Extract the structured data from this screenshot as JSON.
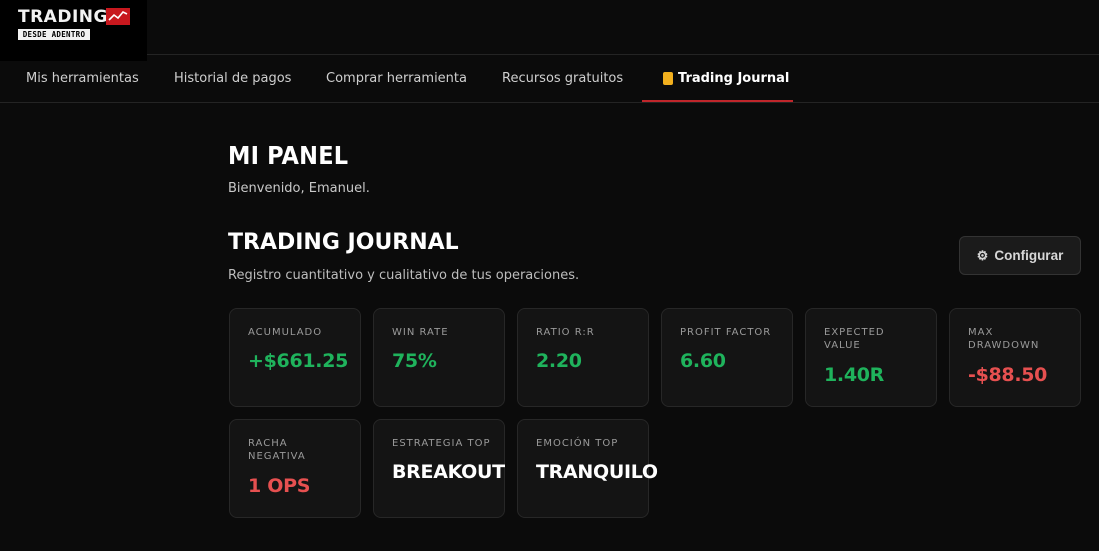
{
  "brand": {
    "name": "TRADING",
    "tagline": "DESDE ADENTRO",
    "accent": "#c8181e"
  },
  "nav": {
    "items": [
      {
        "label": "Mis herramientas",
        "active": false
      },
      {
        "label": "Historial de pagos",
        "active": false
      },
      {
        "label": "Comprar herramienta",
        "active": false
      },
      {
        "label": "Recursos gratuitos",
        "active": false
      },
      {
        "label": "Trading Journal",
        "active": true,
        "icon": "journal-icon"
      }
    ],
    "active_color": "#c0262b"
  },
  "panel": {
    "title": "MI PANEL",
    "welcome": "Bienvenido, Emanuel."
  },
  "journal": {
    "title": "TRADING JOURNAL",
    "subtitle": "Registro cuantitativo y cualitativo de tus operaciones.",
    "configure_label": "Configurar",
    "configure_icon": "gear-icon"
  },
  "stats": [
    {
      "label": "ACUMULADO",
      "value": "+$661.25",
      "tone": "green"
    },
    {
      "label": "WIN RATE",
      "value": "75%",
      "tone": "green"
    },
    {
      "label": "RATIO R:R",
      "value": "2.20",
      "tone": "green"
    },
    {
      "label": "PROFIT FACTOR",
      "value": "6.60",
      "tone": "green"
    },
    {
      "label": "EXPECTED VALUE",
      "value": "1.40R",
      "tone": "green"
    },
    {
      "label": "MAX DRAWDOWN",
      "value": "-$88.50",
      "tone": "red"
    },
    {
      "label": "RACHA NEGATIVA",
      "value": "1 OPS",
      "tone": "red"
    },
    {
      "label": "ESTRATEGIA TOP",
      "value": "BREAKOUT",
      "tone": "white"
    },
    {
      "label": "EMOCIÓN TOP",
      "value": "TRANQUILO",
      "tone": "white"
    }
  ],
  "colors": {
    "positive": "#1fb35c",
    "negative": "#e65050",
    "background": "#0b0b0b",
    "card": "#141414"
  }
}
